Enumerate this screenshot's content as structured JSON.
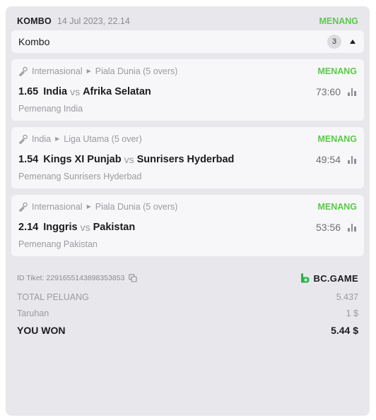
{
  "header": {
    "type": "KOMBO",
    "datetime": "14 Jul 2023, 22.14",
    "status": "MENANG"
  },
  "combo_bar": {
    "label": "Kombo",
    "count": "3"
  },
  "bets": [
    {
      "sport": "Internasional",
      "league": "Piala Dunia (5 overs)",
      "status": "MENANG",
      "odds": "1.65",
      "team1": "India",
      "vs": "vs",
      "team2": "Afrika Selatan",
      "score": "73:60",
      "result": "Pemenang India"
    },
    {
      "sport": "India",
      "league": "Liga Utama (5 over)",
      "status": "MENANG",
      "odds": "1.54",
      "team1": "Kings XI Punjab",
      "vs": "vs",
      "team2": "Sunrisers Hyderbad",
      "score": "49:54",
      "result": "Pemenang Sunrisers Hyderbad"
    },
    {
      "sport": "Internasional",
      "league": "Piala Dunia (5 overs)",
      "status": "MENANG",
      "odds": "2.14",
      "team1": "Inggris",
      "vs": "vs",
      "team2": "Pakistan",
      "score": "53:56",
      "result": "Pemenang Pakistan"
    }
  ],
  "ticket": {
    "label": "ID Tiket: 2291655143898353853",
    "brand": "BC.GAME"
  },
  "summary": {
    "total_odds_label": "TOTAL PELUANG",
    "total_odds_value": "5.437",
    "stake_label": "Taruhan",
    "stake_value": "1 $",
    "won_label": "YOU WON",
    "won_value": "5.44 $"
  },
  "colors": {
    "win": "#5cc94c",
    "card_bg": "#e8e8ec",
    "inner_bg": "#f7f7f9"
  }
}
